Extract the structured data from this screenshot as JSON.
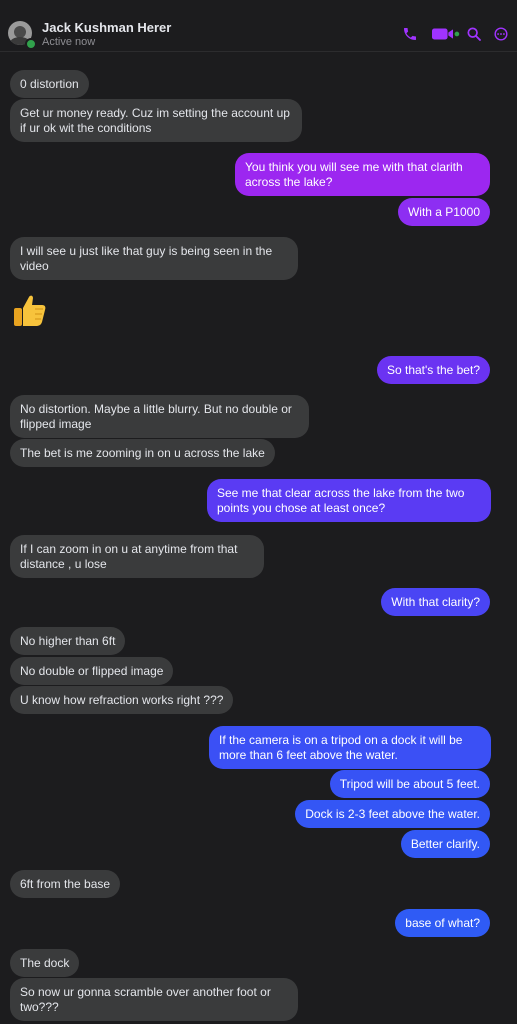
{
  "header": {
    "contact_name": "Jack Kushman Herer",
    "status": "Active now",
    "icons": [
      "phone-icon",
      "video-icon",
      "search-icon",
      "more-icon"
    ]
  },
  "colors": {
    "incoming": "#3a3b3c",
    "outgoing_top": "#9d2cf2",
    "outgoing_bottom": "#2f5bf5",
    "online": "#31a24c",
    "header_icons": "#a033ff"
  },
  "messages": [
    {
      "from": "them",
      "text": "0 distortion"
    },
    {
      "from": "them",
      "text": "Get ur money ready. Cuz im setting the account up if ur ok wit the conditions"
    },
    {
      "from": "me",
      "text": "You think you will see me with that clarith across the lake?"
    },
    {
      "from": "me",
      "text": "With a P1000"
    },
    {
      "from": "them",
      "text": "I will see u just like that guy is being seen in the video"
    },
    {
      "from": "them",
      "emoji": "thumbs-up"
    },
    {
      "from": "me",
      "text": "So that's the bet?"
    },
    {
      "from": "them",
      "text": "No distortion. Maybe a little blurry. But no double or flipped image"
    },
    {
      "from": "them",
      "text": "The bet is me zooming in on u across the lake"
    },
    {
      "from": "me",
      "text": "See me that clear across the lake from the two points you chose at least once?"
    },
    {
      "from": "them",
      "text": "If I can zoom in on u at anytime from that distance , u lose"
    },
    {
      "from": "me",
      "text": "With that clarity?"
    },
    {
      "from": "them",
      "text": "No higher than 6ft"
    },
    {
      "from": "them",
      "text": "No double or flipped image"
    },
    {
      "from": "them",
      "text": "U know how refraction works right ???"
    },
    {
      "from": "me",
      "text": "If the camera is on a tripod on a dock it will be more than 6 feet above the water."
    },
    {
      "from": "me",
      "text": "Tripod will be about 5 feet."
    },
    {
      "from": "me",
      "text": "Dock is 2-3 feet above the water."
    },
    {
      "from": "me",
      "text": "Better clarify."
    },
    {
      "from": "them",
      "text": "6ft from the base"
    },
    {
      "from": "me",
      "text": "base of what?"
    },
    {
      "from": "them",
      "text": "The dock"
    },
    {
      "from": "them",
      "text": "So now ur gonna scramble over another foot or two???"
    }
  ]
}
